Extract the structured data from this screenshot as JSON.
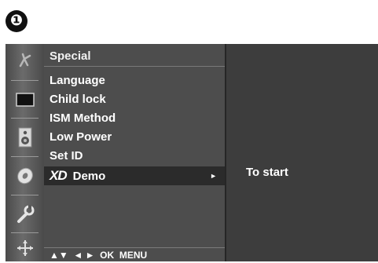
{
  "step_number": "❶",
  "menu": {
    "title": "Special",
    "items": [
      {
        "label": "Language"
      },
      {
        "label": "Child lock"
      },
      {
        "label": "ISM Method"
      },
      {
        "label": "Low Power"
      },
      {
        "label": "Set ID"
      }
    ],
    "selected_item": {
      "logo": "XD",
      "label": "Demo",
      "arrow": "►"
    },
    "nav_hint": "▲▼  ◄ ►  OK  MENU"
  },
  "submenu": {
    "text": "To start"
  },
  "icons": [
    "picture-icon",
    "screen-icon",
    "speaker-icon",
    "disc-icon",
    "settings-icon",
    "move-icon"
  ],
  "colors": {
    "osd_bg": "#3f3f3f",
    "panel_bg": "#4d4d4d",
    "selected_bg": "#2b2b2b",
    "text": "#ffffff"
  }
}
